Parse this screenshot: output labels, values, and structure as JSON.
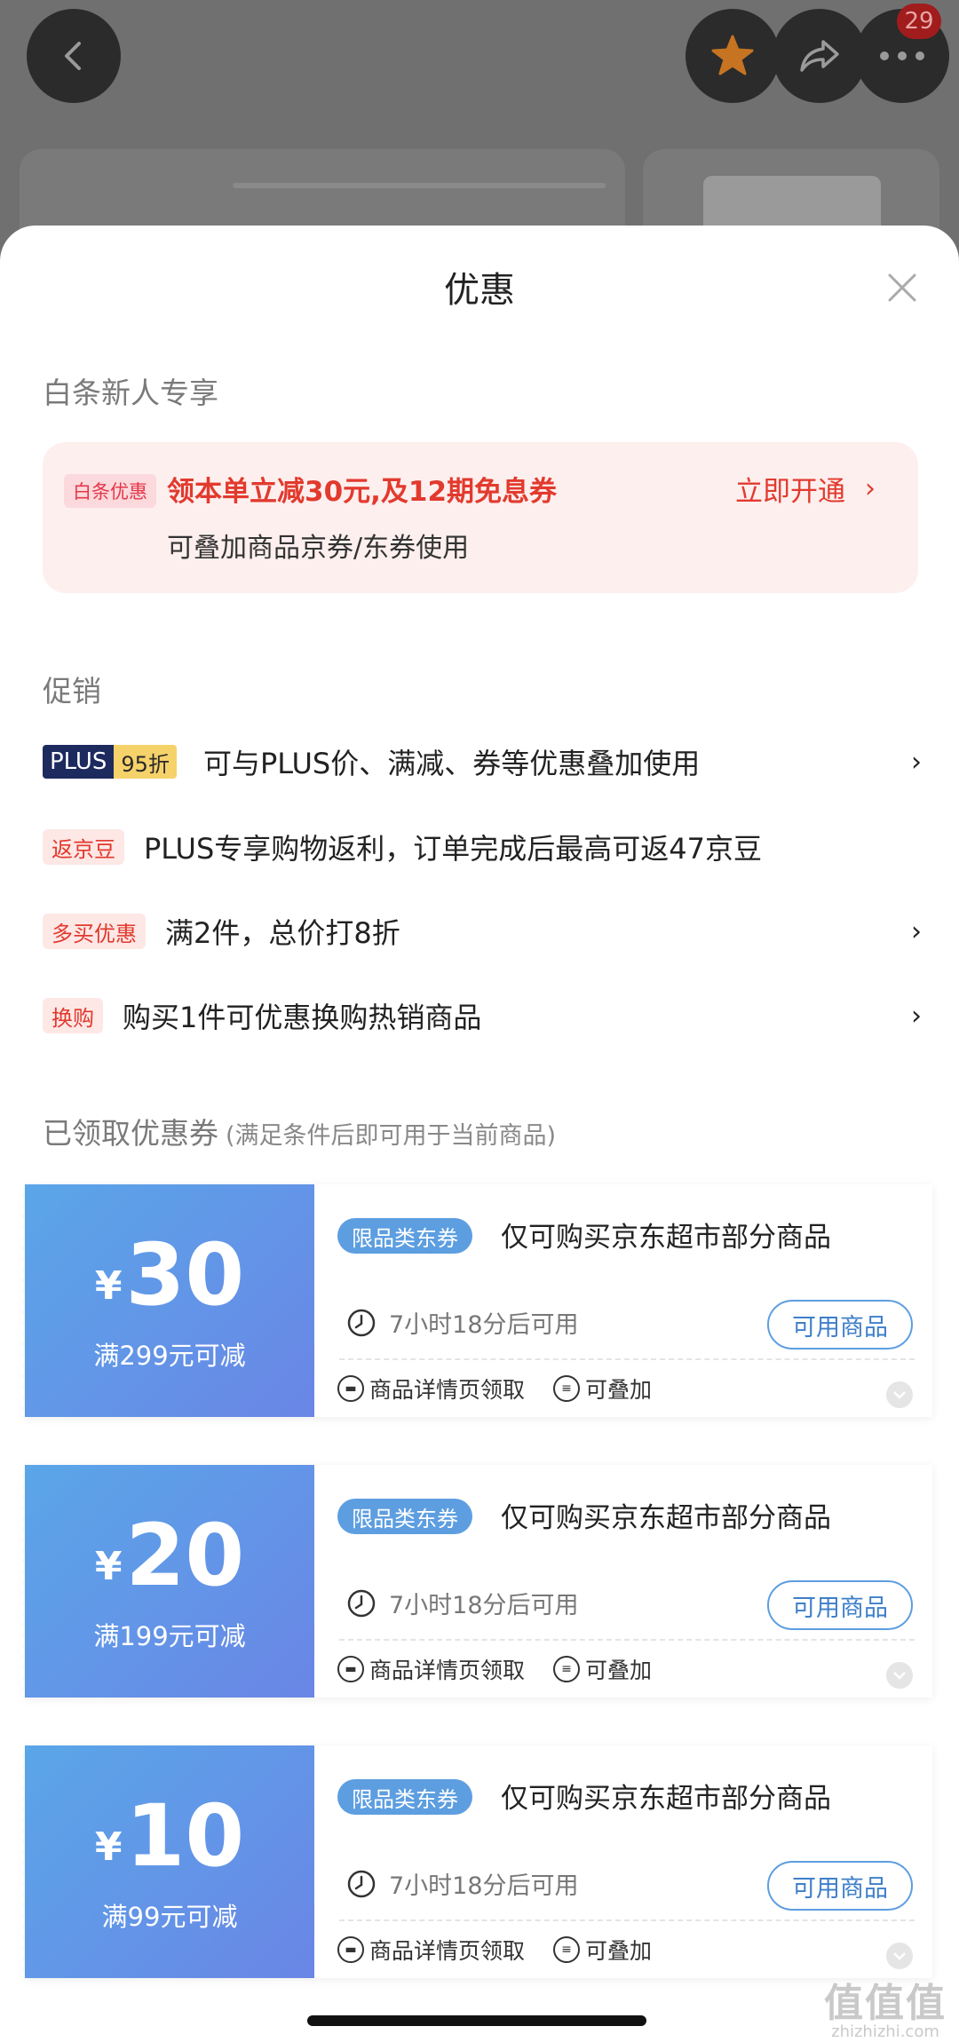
{
  "topbar": {
    "notification_count": "29"
  },
  "sheet": {
    "title": "优惠",
    "baitiao": {
      "section_title": "白条新人专享",
      "tag": "白条优惠",
      "main_text": "领本单立减30元,及12期免息券",
      "sub_text": "可叠加商品京券/东券使用",
      "action": "立即开通"
    },
    "promo": {
      "section_title": "促销",
      "rows": [
        {
          "tag_left": "PLUS",
          "tag_right": "95折",
          "text": "可与PLUS价、满减、券等优惠叠加使用",
          "has_arrow": true
        },
        {
          "tag": "返京豆",
          "text": "PLUS专享购物返利，订单完成后最高可返47京豆",
          "has_arrow": false
        },
        {
          "tag": "多买优惠",
          "text": "满2件，总价打8折",
          "has_arrow": true
        },
        {
          "tag": "换购",
          "text": "购买1件可优惠换购热销商品",
          "has_arrow": true
        }
      ]
    },
    "coupons": {
      "section_title": "已领取优惠券",
      "section_hint": "(满足条件后即可用于当前商品)",
      "items": [
        {
          "currency": "¥",
          "amount": "30",
          "condition": "满299元可减",
          "type": "限品类东券",
          "desc": "仅可购买京东超市部分商品",
          "time": "7小时18分后可用",
          "button": "可用商品",
          "source": "商品详情页领取",
          "stack": "可叠加"
        },
        {
          "currency": "¥",
          "amount": "20",
          "condition": "满199元可减",
          "type": "限品类东券",
          "desc": "仅可购买京东超市部分商品",
          "time": "7小时18分后可用",
          "button": "可用商品",
          "source": "商品详情页领取",
          "stack": "可叠加"
        },
        {
          "currency": "¥",
          "amount": "10",
          "condition": "满99元可减",
          "type": "限品类东券",
          "desc": "仅可购买京东超市部分商品",
          "time": "7小时18分后可用",
          "button": "可用商品",
          "source": "商品详情页领取",
          "stack": "可叠加"
        }
      ]
    }
  },
  "watermark": {
    "title": "值值值",
    "site": "zhizhizhi.com"
  },
  "colors": {
    "accent_red": "#e23a2e",
    "coupon_blue": "#5d9ee0",
    "plus_navy": "#1c2a5e",
    "plus_gold": "#f6d26a"
  }
}
